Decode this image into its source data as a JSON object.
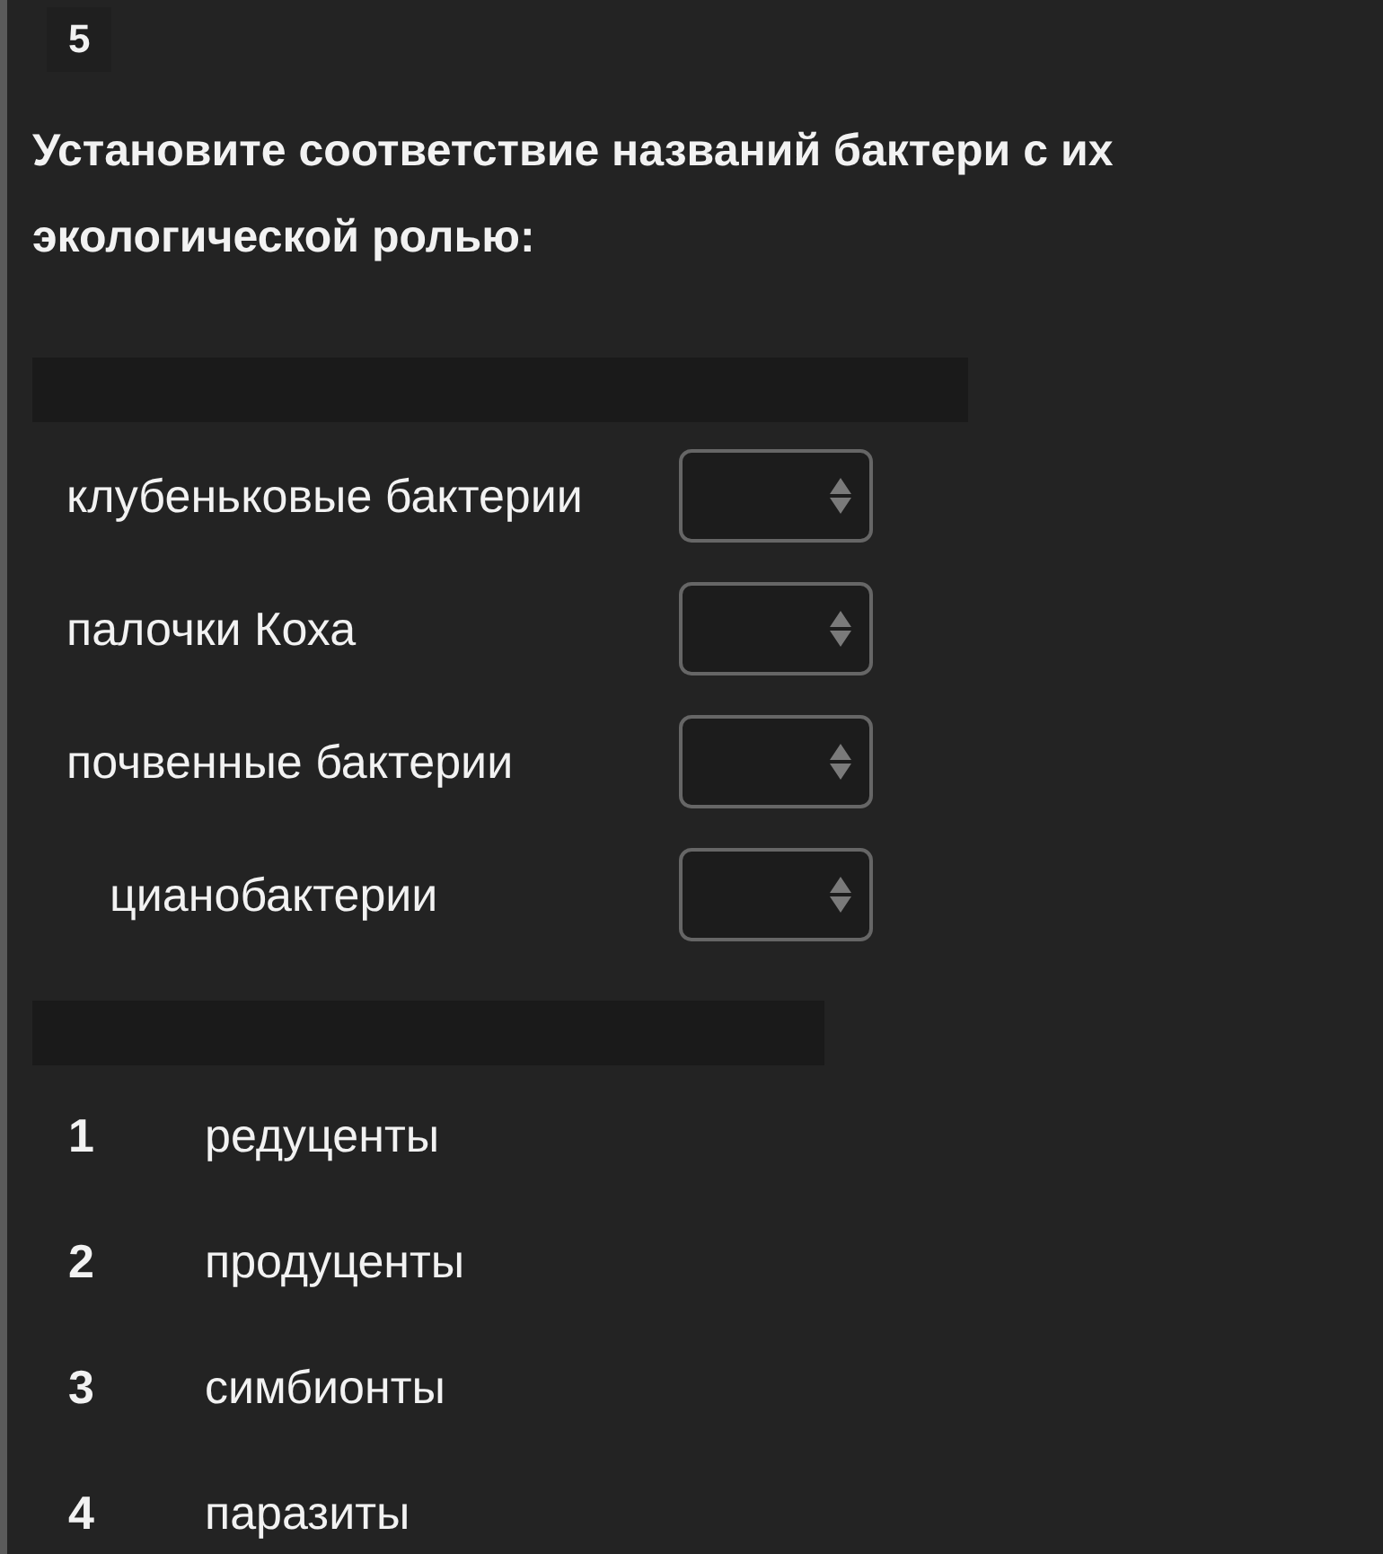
{
  "question_number": "5",
  "question": "Установите соответствие названий бактери с их экологической ролью:",
  "matches": [
    {
      "label": "клубеньковые бактерии"
    },
    {
      "label": "палочки Коха"
    },
    {
      "label": "почвенные бактерии"
    },
    {
      "label": "цианобактерии"
    }
  ],
  "options": [
    {
      "number": "1",
      "text": "редуценты"
    },
    {
      "number": "2",
      "text": "продуценты"
    },
    {
      "number": "3",
      "text": "симбионты"
    },
    {
      "number": "4",
      "text": "паразиты"
    }
  ]
}
